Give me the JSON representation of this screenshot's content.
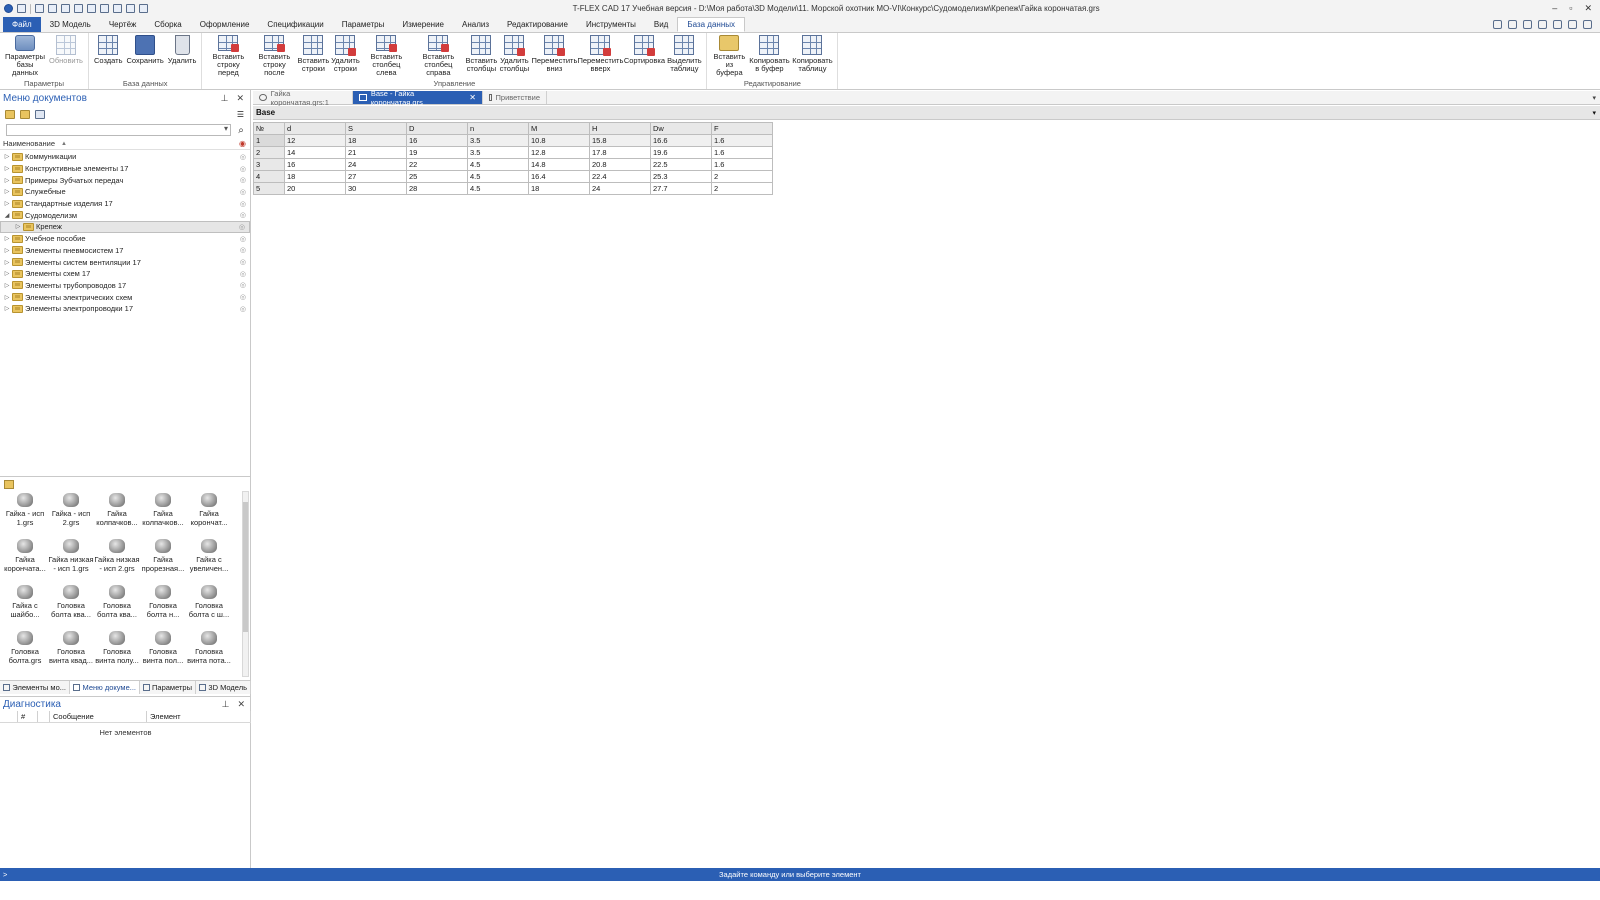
{
  "window": {
    "title": "T-FLEX CAD 17 Учебная версия - D:\\Моя работа\\3D Модели\\11. Морской охотник МО-VI\\Конкурс\\Судомоделизм\\Крепеж\\Гайка корончатая.grs"
  },
  "ribbon_tabs": [
    "Файл",
    "3D Модель",
    "Чертёж",
    "Сборка",
    "Оформление",
    "Спецификации",
    "Параметры",
    "Измерение",
    "Анализ",
    "Редактирование",
    "Инструменты",
    "Вид",
    "База данных"
  ],
  "ribbon": {
    "groups": [
      {
        "label": "Параметры",
        "buttons": [
          {
            "label": "Параметры базы данных",
            "icon": "db-params-icon",
            "enabled": true
          },
          {
            "label": "Обновить",
            "icon": "refresh-icon",
            "enabled": false
          }
        ]
      },
      {
        "label": "База данных",
        "buttons": [
          {
            "label": "Создать",
            "icon": "create-db-icon",
            "enabled": true
          },
          {
            "label": "Сохранить",
            "icon": "save-db-icon",
            "enabled": true
          },
          {
            "label": "Удалить",
            "icon": "trash-icon",
            "enabled": true
          }
        ]
      },
      {
        "label": "Управление",
        "buttons": [
          {
            "label": "Вставить строку перед",
            "icon": "insert-row-before-icon",
            "enabled": true
          },
          {
            "label": "Вставить строку после",
            "icon": "insert-row-after-icon",
            "enabled": true
          },
          {
            "label": "Вставить строки",
            "icon": "insert-rows-icon",
            "enabled": true
          },
          {
            "label": "Удалить строки",
            "icon": "delete-rows-icon",
            "enabled": true
          },
          {
            "label": "Вставить столбец слева",
            "icon": "insert-col-left-icon",
            "enabled": true
          },
          {
            "label": "Вставить столбец справа",
            "icon": "insert-col-right-icon",
            "enabled": true
          },
          {
            "label": "Вставить столбцы",
            "icon": "insert-cols-icon",
            "enabled": true
          },
          {
            "label": "Удалить столбцы",
            "icon": "delete-cols-icon",
            "enabled": true
          },
          {
            "label": "Переместить вниз",
            "icon": "move-down-icon",
            "enabled": true
          },
          {
            "label": "Переместить вверх",
            "icon": "move-up-icon",
            "enabled": true
          },
          {
            "label": "Сортировка",
            "icon": "sort-icon",
            "enabled": true
          },
          {
            "label": "Выделить таблицу",
            "icon": "select-table-icon",
            "enabled": true
          }
        ]
      },
      {
        "label": "Редактирование",
        "buttons": [
          {
            "label": "Вставить из буфера",
            "icon": "paste-icon",
            "enabled": true
          },
          {
            "label": "Копировать в буфер",
            "icon": "copy-icon",
            "enabled": true
          },
          {
            "label": "Копировать таблицу",
            "icon": "copy-table-icon",
            "enabled": true
          }
        ]
      }
    ]
  },
  "left_panel": {
    "title": "Меню документов",
    "column_header": "Наименование",
    "tree": [
      {
        "label": "Коммуникации",
        "expanded": false,
        "child": false,
        "selected": false
      },
      {
        "label": "Конструктивные элементы 17",
        "expanded": false,
        "child": false,
        "selected": false
      },
      {
        "label": "Примеры Зубчатых передач",
        "expanded": false,
        "child": false,
        "selected": false
      },
      {
        "label": "Служебные",
        "expanded": false,
        "child": false,
        "selected": false
      },
      {
        "label": "Стандартные изделия 17",
        "expanded": false,
        "child": false,
        "selected": false
      },
      {
        "label": "Судомоделизм",
        "expanded": true,
        "child": false,
        "selected": false
      },
      {
        "label": "Крепеж",
        "expanded": false,
        "child": true,
        "selected": true
      },
      {
        "label": "Учебное пособие",
        "expanded": false,
        "child": false,
        "selected": false
      },
      {
        "label": "Элементы пневмосистем 17",
        "expanded": false,
        "child": false,
        "selected": false
      },
      {
        "label": "Элементы систем вентиляции 17",
        "expanded": false,
        "child": false,
        "selected": false
      },
      {
        "label": "Элементы схем 17",
        "expanded": false,
        "child": false,
        "selected": false
      },
      {
        "label": "Элементы трубопроводов 17",
        "expanded": false,
        "child": false,
        "selected": false
      },
      {
        "label": "Элементы электрических схем",
        "expanded": false,
        "child": false,
        "selected": false
      },
      {
        "label": "Элементы электропроводки 17",
        "expanded": false,
        "child": false,
        "selected": false
      }
    ],
    "thumbnails": [
      [
        "Гайка - исп",
        "1.grs"
      ],
      [
        "Гайка - исп",
        "2.grs"
      ],
      [
        "Гайка",
        "колпачков..."
      ],
      [
        "Гайка",
        "колпачков..."
      ],
      [
        "Гайка",
        "корончат..."
      ],
      [
        "Гайка",
        "корончата..."
      ],
      [
        "Гайка низкая",
        "- исп 1.grs"
      ],
      [
        "Гайка низкая",
        "- исп 2.grs"
      ],
      [
        "Гайка",
        "прорезная..."
      ],
      [
        "Гайка с",
        "увеличен..."
      ],
      [
        "Гайка с",
        "шайбо..."
      ],
      [
        "Головка",
        "болта ква..."
      ],
      [
        "Головка",
        "болта ква..."
      ],
      [
        "Головка",
        "болта н..."
      ],
      [
        "Головка",
        "болта с ш..."
      ],
      [
        "Головка",
        "болта.grs"
      ],
      [
        "Головка",
        "винта квад..."
      ],
      [
        "Головка",
        "винта полу..."
      ],
      [
        "Головка",
        "винта пол..."
      ],
      [
        "Головка",
        "винта пота..."
      ]
    ],
    "bottom_tabs": [
      {
        "label": "Элементы мо...",
        "active": false
      },
      {
        "label": "Меню докуме...",
        "active": true
      },
      {
        "label": "Параметры",
        "active": false
      },
      {
        "label": "3D Модель",
        "active": false
      }
    ]
  },
  "diagnostics": {
    "title": "Диагностика",
    "columns": [
      "#",
      "",
      "Сообщение",
      "Элемент"
    ],
    "empty_text": "Нет элементов"
  },
  "doc_tabs": [
    {
      "label": "Гайка корончатая.grs:1",
      "active": false,
      "closable": false
    },
    {
      "label": "Base - Гайка корончатая.grs",
      "active": true,
      "closable": true
    },
    {
      "label": "Приветствие",
      "active": false,
      "closable": false
    }
  ],
  "table": {
    "name": "Base",
    "columns": [
      "№",
      "d",
      "S",
      "D",
      "n",
      "M",
      "H",
      "Dw",
      "F"
    ],
    "rows": [
      [
        "1",
        "12",
        "18",
        "16",
        "3.5",
        "10.8",
        "15.8",
        "16.6",
        "1.6"
      ],
      [
        "2",
        "14",
        "21",
        "19",
        "3.5",
        "12.8",
        "17.8",
        "19.6",
        "1.6"
      ],
      [
        "3",
        "16",
        "24",
        "22",
        "4.5",
        "14.8",
        "20.8",
        "22.5",
        "1.6"
      ],
      [
        "4",
        "18",
        "27",
        "25",
        "4.5",
        "16.4",
        "22.4",
        "25.3",
        "2"
      ],
      [
        "5",
        "20",
        "30",
        "28",
        "4.5",
        "18",
        "24",
        "27.7",
        "2"
      ]
    ],
    "selected_row": 0
  },
  "status": {
    "prompt": ">",
    "message": "Задайте команду или выберите элемент"
  },
  "colors": {
    "accent": "#2b5fb4",
    "folder": "#e9c45f"
  }
}
